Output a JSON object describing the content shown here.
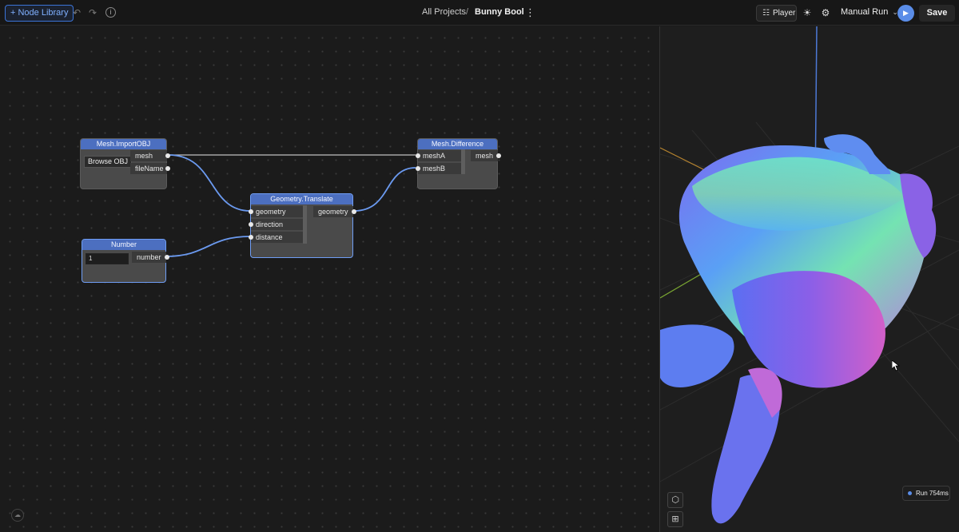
{
  "toolbar": {
    "node_library_label": "+ Node Library",
    "undo_icon": "undo-icon",
    "redo_icon": "redo-icon",
    "info_icon": "info-icon",
    "breadcrumb_root": "All Projects",
    "breadcrumb_sep": "/",
    "project_name": "Bunny Bool",
    "player_label": "Player",
    "run_mode": "Manual Run",
    "save_label": "Save"
  },
  "nodes": {
    "import_obj": {
      "title": "Mesh.ImportOBJ",
      "button": "Browse OBJ",
      "outputs": [
        "mesh",
        "fileName"
      ]
    },
    "difference": {
      "title": "Mesh.Difference",
      "inputs": [
        "meshA",
        "meshB"
      ],
      "outputs": [
        "mesh"
      ]
    },
    "translate": {
      "title": "Geometry.Translate",
      "inputs": [
        "geometry",
        "direction",
        "distance"
      ],
      "outputs": [
        "geometry"
      ]
    },
    "number": {
      "title": "Number",
      "value": "1",
      "outputs": [
        "number"
      ]
    }
  },
  "viewport": {
    "run_status": "Run 754ms",
    "view_icons": [
      "cube-icon",
      "grid-icon"
    ]
  },
  "colors": {
    "accent": "#4c6fc0",
    "wire": "#6b9af0",
    "wire_plain": "#bfbfbf",
    "play": "#5a8de8"
  }
}
